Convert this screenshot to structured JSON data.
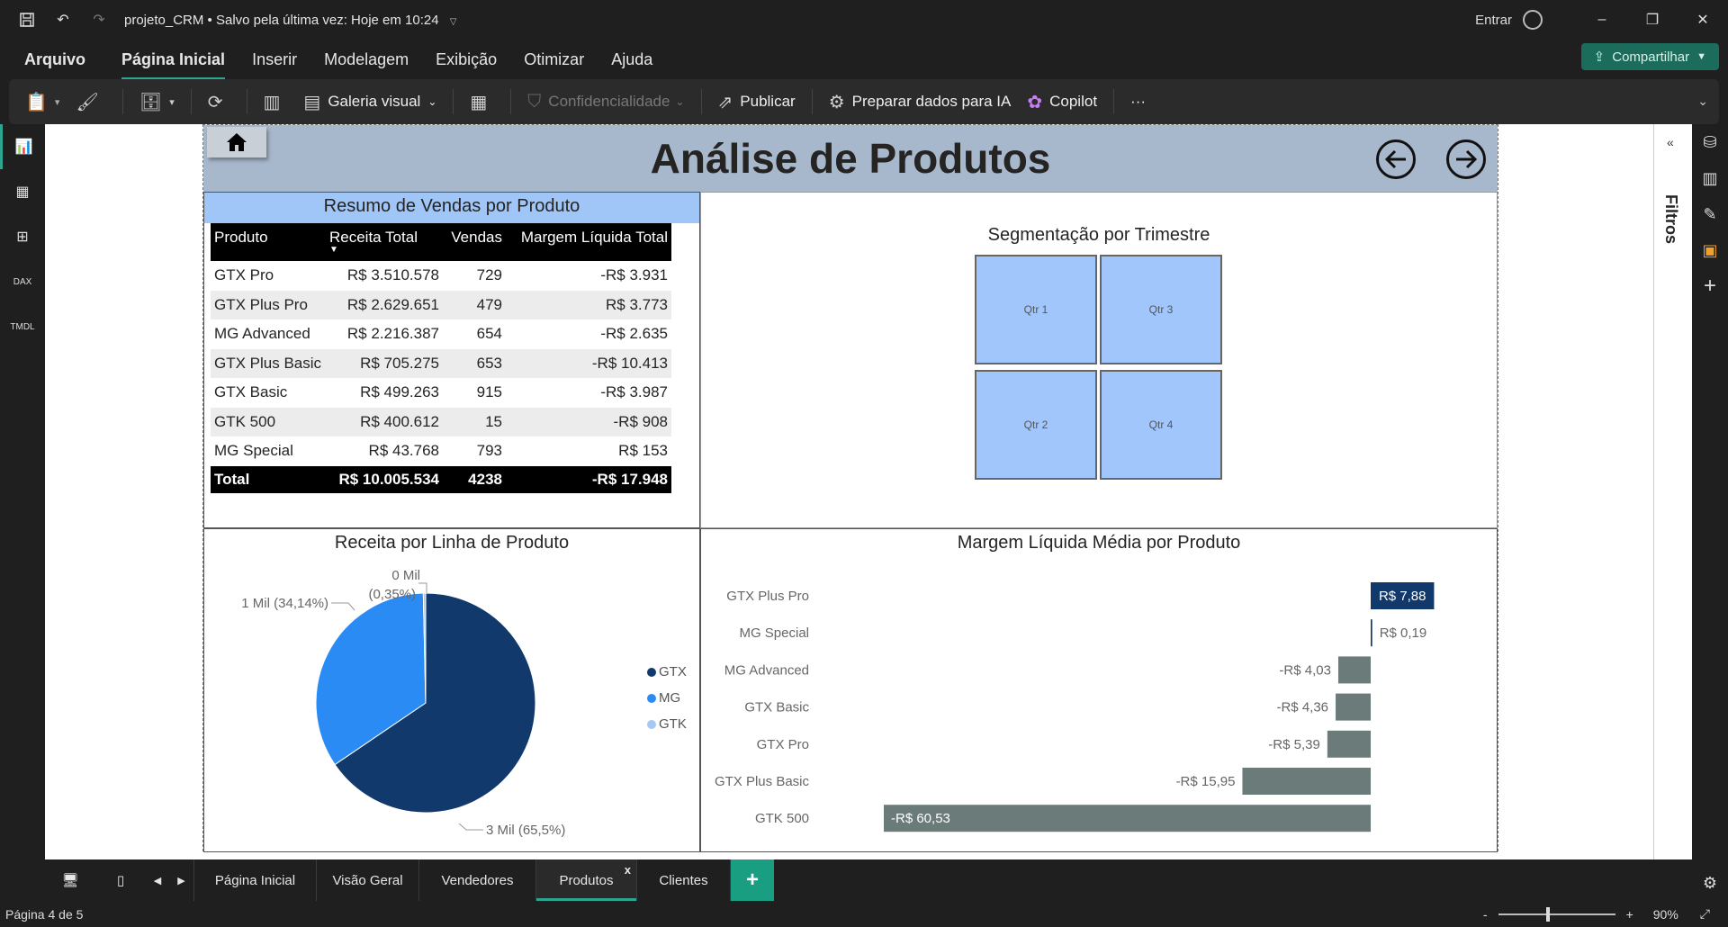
{
  "titlebar": {
    "doc_title": "projeto_CRM",
    "saved_status": "• Salvo pela última vez: Hoje em 10:24",
    "sign_in": "Entrar",
    "minimize": "–",
    "restore": "❐",
    "close": "✕"
  },
  "menu": {
    "items": [
      "Arquivo",
      "Página Inicial",
      "Inserir",
      "Modelagem",
      "Exibição",
      "Otimizar",
      "Ajuda"
    ],
    "share": "Compartilhar"
  },
  "ribbon": {
    "visual_gallery": "Galeria visual",
    "sensitivity": "Confidencialidade",
    "publish": "Publicar",
    "prepare_ai": "Preparar dados para IA",
    "copilot": "Copilot",
    "more": "···"
  },
  "report": {
    "title": "Análise de Produtos",
    "table_title": "Resumo de Vendas por Produto",
    "table": {
      "headers": [
        "Produto",
        "Receita Total",
        "Vendas",
        "Margem Líquida Total"
      ],
      "rows": [
        [
          "GTX Pro",
          "R$ 3.510.578",
          "729",
          "-R$ 3.931"
        ],
        [
          "GTX Plus Pro",
          "R$ 2.629.651",
          "479",
          "R$ 3.773"
        ],
        [
          "MG Advanced",
          "R$ 2.216.387",
          "654",
          "-R$ 2.635"
        ],
        [
          "GTX Plus Basic",
          "R$ 705.275",
          "653",
          "-R$ 10.413"
        ],
        [
          "GTX Basic",
          "R$ 499.263",
          "915",
          "-R$ 3.987"
        ],
        [
          "GTK 500",
          "R$ 400.612",
          "15",
          "-R$ 908"
        ],
        [
          "MG Special",
          "R$ 43.768",
          "793",
          "R$ 153"
        ]
      ],
      "total": [
        "Total",
        "R$ 10.005.534",
        "4238",
        "-R$ 17.948"
      ]
    },
    "slicer": {
      "title": "Segmentação por Trimestre",
      "tiles": [
        "Qtr 1",
        "Qtr 3",
        "Qtr 2",
        "Qtr 4"
      ]
    }
  },
  "chart_data": [
    {
      "type": "pie",
      "title": "Receita por Linha de Produto",
      "categories": [
        "GTX",
        "MG",
        "GTK"
      ],
      "values": [
        65.5,
        34.14,
        0.35
      ],
      "data_labels": [
        "3 Mil (65,5%)",
        "1 Mil (34,14%)",
        "0 Mil",
        "(0,35%)"
      ],
      "colors": [
        "#12396b",
        "#2b8bf5",
        "#a6c8f5"
      ],
      "legend_position": "right"
    },
    {
      "type": "bar",
      "orientation": "horizontal",
      "title": "Margem Líquida Média por Produto",
      "categories": [
        "GTX Plus Pro",
        "MG Special",
        "MG Advanced",
        "GTX Basic",
        "GTX Pro",
        "GTX Plus Basic",
        "GTK 500"
      ],
      "values": [
        7.88,
        0.19,
        -4.03,
        -4.36,
        -5.39,
        -15.95,
        -60.53
      ],
      "data_labels": [
        "R$ 7,88",
        "R$ 0,19",
        "-R$ 4,03",
        "-R$ 4,36",
        "-R$ 5,39",
        "-R$ 15,95",
        "-R$ 60,53"
      ],
      "colors": {
        "positive": "#12396b",
        "negative": "#6b7b7a"
      }
    }
  ],
  "tabs": {
    "pages": [
      "Página Inicial",
      "Visão Geral",
      "Vendedores",
      "Produtos",
      "Clientes"
    ],
    "active": "Produtos",
    "close": "x",
    "add": "+"
  },
  "status": {
    "page_info": "Página 4 de 5",
    "zoom_level": "90%",
    "zoom_out": "-",
    "zoom_in": "+",
    "filters_label": "Filtros"
  }
}
